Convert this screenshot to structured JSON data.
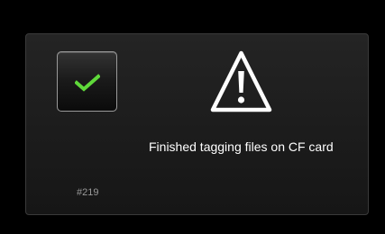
{
  "dialog": {
    "message": "Finished tagging files on CF card",
    "code": "#219",
    "ok_icon": "checkmark-icon",
    "status_icon": "warning-triangle-icon",
    "colors": {
      "check": "#5fd93a",
      "text": "#ffffff",
      "code_text": "#9a9a9a",
      "background": "#000000"
    }
  }
}
